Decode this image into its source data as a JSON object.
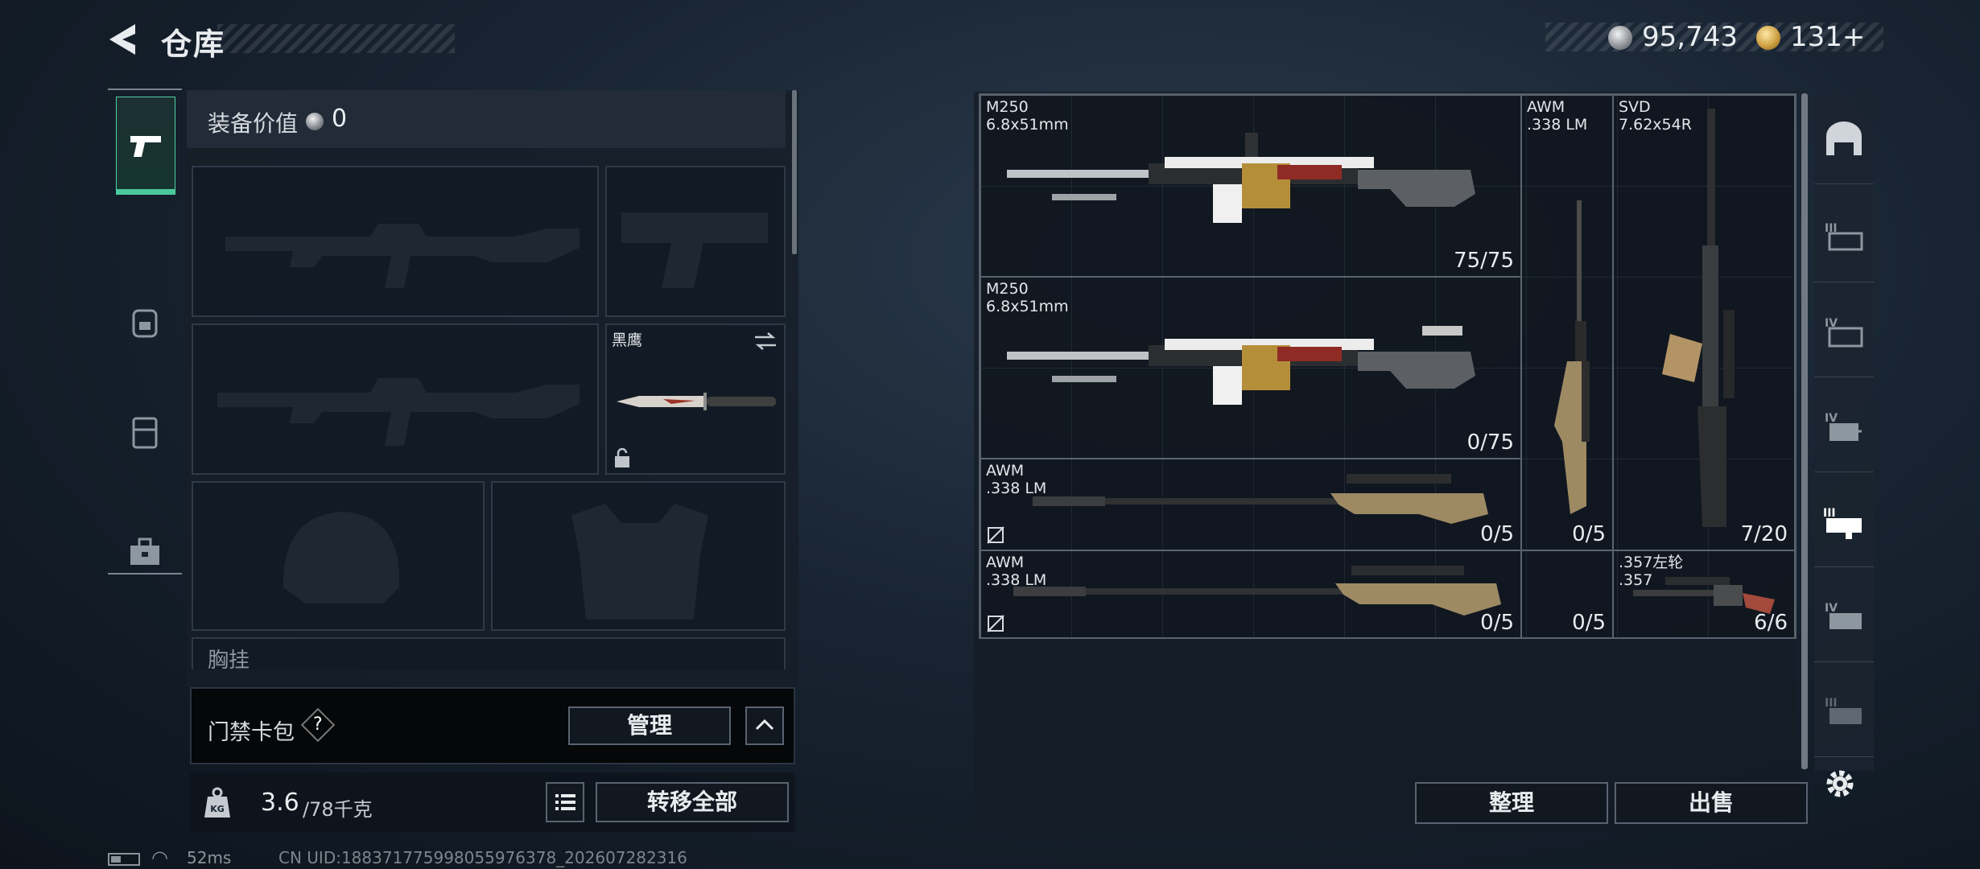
{
  "header": {
    "title": "仓库",
    "currency_silver": "95,743",
    "currency_gold": "131+"
  },
  "equipment": {
    "value_label": "装备价值",
    "value": "0",
    "chest_label": "胸挂",
    "melee_name": "黑鹰"
  },
  "card_bag": {
    "label": "门禁卡包",
    "help": "?",
    "manage_label": "管理"
  },
  "weight": {
    "current": "3.6",
    "max": "/78千克",
    "transfer_label": "转移全部"
  },
  "status": {
    "ping": "52ms",
    "uid": "CN UID:1883717759980559763​78_202607282316"
  },
  "storage": {
    "items": [
      {
        "name": "M250",
        "ammo": "6.8x51mm",
        "count": "75/75"
      },
      {
        "name": "M250",
        "ammo": "6.8x51mm",
        "count": "0/75"
      },
      {
        "name": "AWM",
        "ammo": ".338 LM",
        "count": "0/5"
      },
      {
        "name": "SVD",
        "ammo": "7.62x54R",
        "count": "7/20"
      },
      {
        "name": "AWM",
        "ammo": ".338 LM",
        "count": "0/5"
      },
      {
        "name": "AWM",
        "ammo": ".338 LM",
        "count": "0/5"
      },
      {
        "name": ".357左轮",
        "ammo": ".357",
        "count": "6/6"
      }
    ],
    "sort_label": "整理",
    "sell_label": "出售"
  },
  "colors": {
    "accent_green": "#49c99a",
    "background": "#182432",
    "border": "#596370"
  },
  "icons": [
    "back-arrow-icon",
    "pistol-icon",
    "backpack-icon",
    "vest-icon",
    "toolbox-icon",
    "silver-coin-icon",
    "gold-coin-icon",
    "weight-icon",
    "list-icon",
    "safe-icon",
    "settings-icon",
    "swap-icon",
    "lock-icon",
    "no-ammo-icon"
  ]
}
